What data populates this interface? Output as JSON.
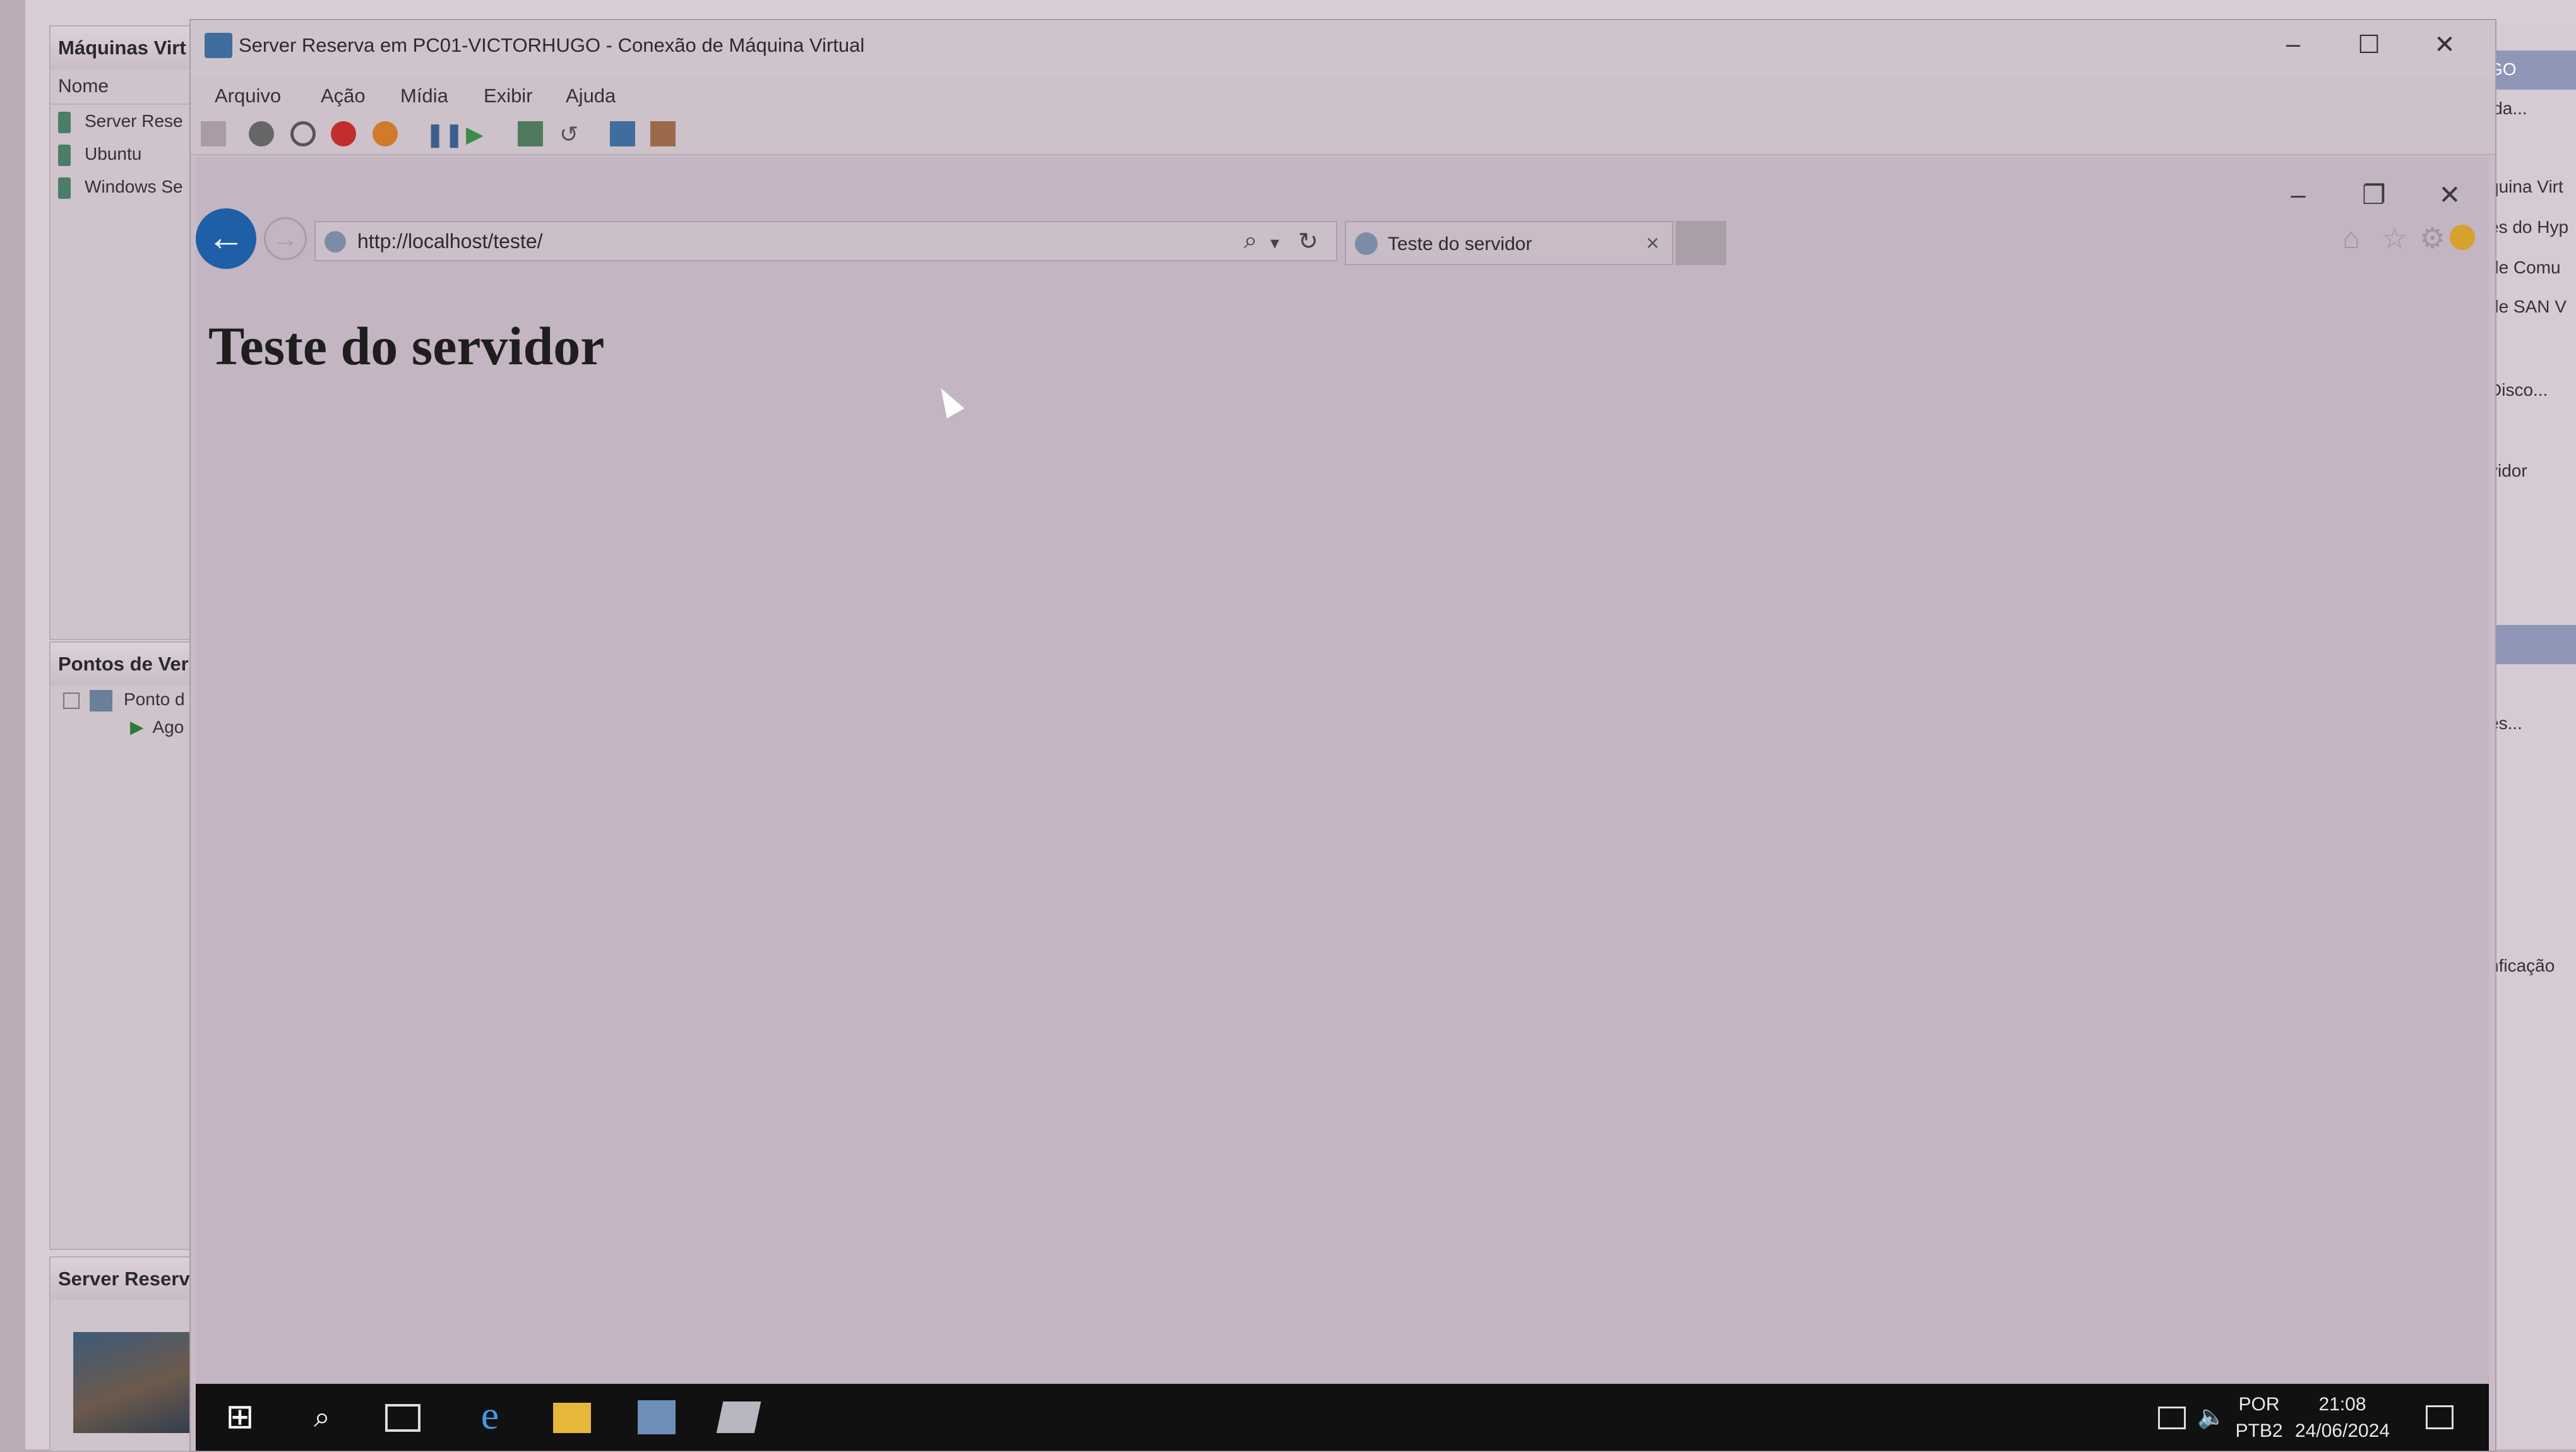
{
  "host": {
    "vm_panel_title": "Máquinas Virt",
    "vm_column_header": "Nome",
    "vms": [
      "Server Rese",
      "Ubuntu",
      "Windows Se"
    ],
    "checkpoints_title": "Pontos de Ver",
    "checkpoints": [
      "Ponto d",
      "Ago"
    ],
    "details_title": "Server Reserv",
    "actions_panel": [
      "GO",
      "ida...",
      "quina Virt",
      "es do Hyp",
      "de Comu",
      "de SAN V",
      "Disco...",
      "vidor",
      "es...",
      "nficação"
    ]
  },
  "vm_window": {
    "title": "Server Reserva em PC01-VICTORHUGO - Conexão de Máquina Virtual",
    "menu": [
      "Arquivo",
      "Ação",
      "Mídia",
      "Exibir",
      "Ajuda"
    ],
    "controls": {
      "minimize": "–",
      "maximize": "☐",
      "close": "✕"
    }
  },
  "browser": {
    "url": "http://localhost/teste/",
    "tab_title": "Teste do servidor",
    "controls": {
      "minimize": "–",
      "restore": "❐",
      "close": "✕"
    },
    "page_heading": "Teste do servidor"
  },
  "taskbar": {
    "lang_top": "POR",
    "lang_bottom": "PTB2",
    "time": "21:08",
    "date": "24/06/2024"
  },
  "colors": {
    "back_button": "#1f5fa8",
    "taskbar": "#111111",
    "page_bg": "#c3b5c1"
  },
  "icons": [
    "start-icon",
    "search-icon",
    "task-view-icon",
    "internet-explorer-icon",
    "file-explorer-icon",
    "server-manager-icon",
    "powershell-icon",
    "network-icon",
    "volume-icon",
    "notification-icon"
  ]
}
